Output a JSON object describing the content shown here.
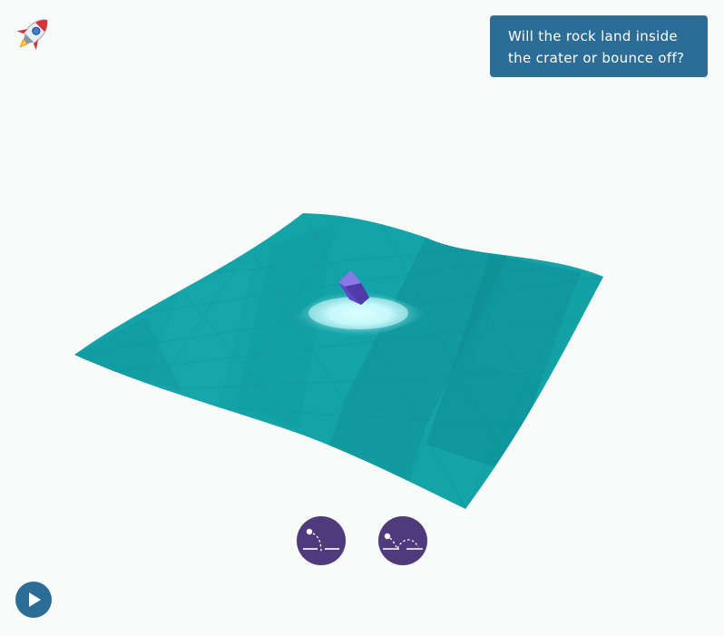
{
  "app": {
    "logo_icon": "rocket-icon"
  },
  "prompt": {
    "line1": "Will the rock land inside",
    "line2": "the crater or bounce off?"
  },
  "choices": [
    {
      "id": "land-inside",
      "icon": "rock-land-trajectory-icon"
    },
    {
      "id": "bounce-off",
      "icon": "rock-bounce-trajectory-icon"
    }
  ],
  "controls": {
    "play_icon": "play-icon"
  },
  "colors": {
    "background": "#f8fbf9",
    "terrain": "#14a3a8",
    "terrain_dark": "#0e9096",
    "crater_glow": "#c9fbff",
    "rock": "#6a55cf",
    "rock_top": "#8a77e8",
    "bubble": "#2b6d96",
    "choice_button": "#4f3a7c",
    "play_button": "#2b6d96"
  }
}
